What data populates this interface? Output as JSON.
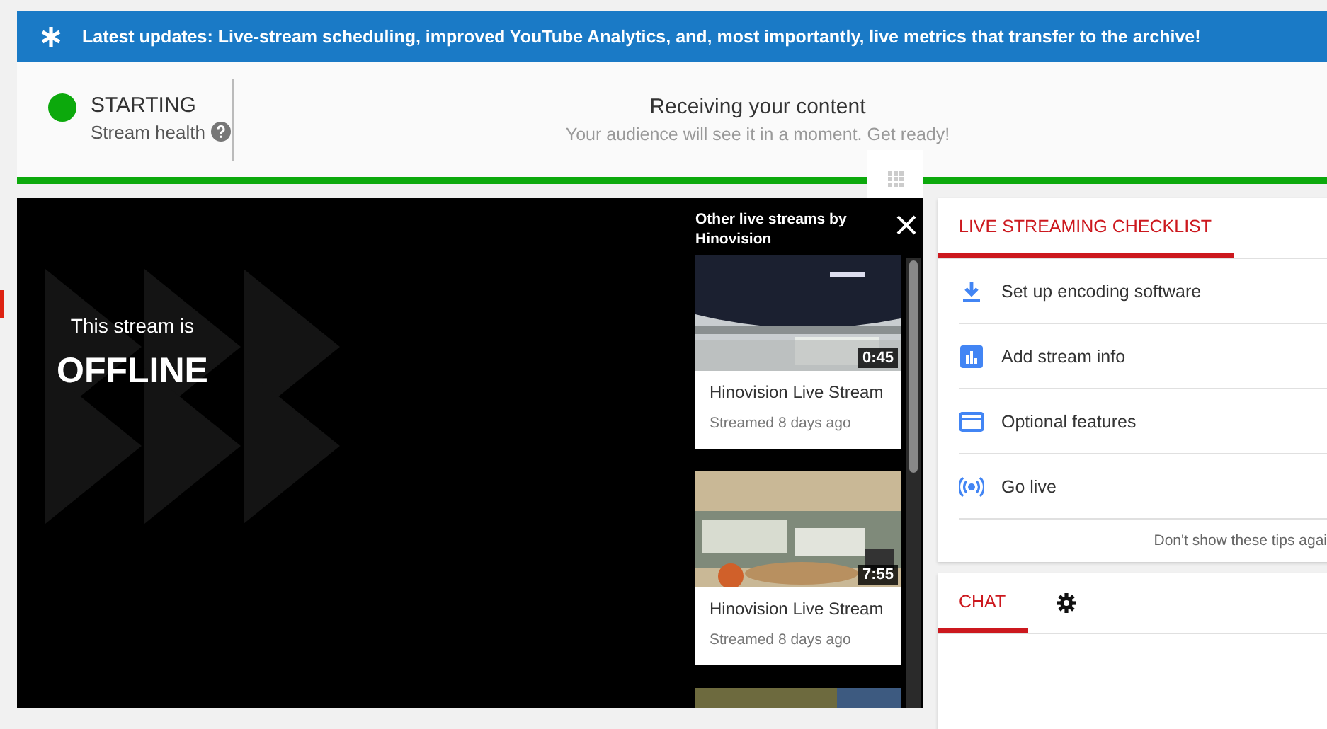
{
  "banner": {
    "text": "Latest updates: Live-stream scheduling, improved YouTube Analytics, and, most importantly, live metrics that transfer to the archive!"
  },
  "health": {
    "status": "STARTING",
    "color": "#0ca90c",
    "label": "Stream health",
    "title": "Receiving your content",
    "subtitle": "Your audience will see it in a moment. Get ready!",
    "level": 1
  },
  "player": {
    "line1": "This stream is",
    "line2": "OFFLINE",
    "sidebar_title": "Other live streams by Hinovision",
    "videos": [
      {
        "duration": "0:45",
        "title": "Hinovision Live Stream",
        "meta": "Streamed 8 days ago"
      },
      {
        "duration": "7:55",
        "title": "Hinovision Live Stream",
        "meta": "Streamed 8 days ago"
      }
    ]
  },
  "checklist": {
    "tab": {
      "label": "LIVE STREAMING CHECKLIST",
      "selected": true
    },
    "items": [
      {
        "kind": "download",
        "label": "Set up encoding software"
      },
      {
        "kind": "info",
        "label": "Add stream info"
      },
      {
        "kind": "card",
        "label": "Optional features"
      },
      {
        "kind": "live",
        "label": "Go live"
      }
    ],
    "dismiss": "Don't show these tips agai"
  },
  "chat": {
    "tab": {
      "label": "CHAT",
      "selected": true
    }
  }
}
